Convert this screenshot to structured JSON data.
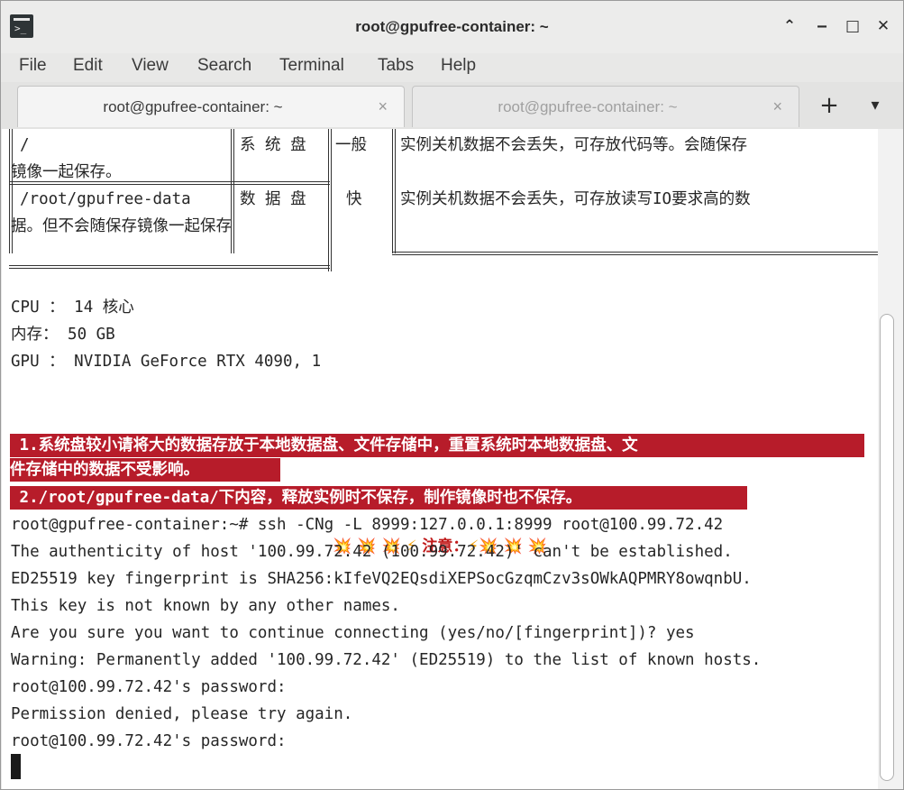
{
  "window": {
    "title": "root@gpufree-container: ~",
    "icon": "terminal-icon",
    "controls": {
      "up": "⌃",
      "minimize": "‒",
      "maximize": "□",
      "close": "✕"
    }
  },
  "menu": [
    "File",
    "Edit",
    "View",
    "Search",
    "Terminal",
    "Tabs",
    "Help"
  ],
  "tabs": [
    {
      "label": "root@gpufree-container: ~",
      "active": true,
      "close": "×"
    },
    {
      "label": "root@gpufree-container: ~",
      "active": false,
      "close": "×"
    }
  ],
  "tab_actions": {
    "new_tab": "+",
    "menu": "▾"
  },
  "terminal": {
    "table": {
      "row1_path": "/",
      "row1_type": "系 统 盘",
      "row1_speed": "一般",
      "row1_desc": "实例关机数据不会丢失，可存放代码等。会随保存",
      "row1_cont": "镜像一起保存。",
      "row2_path": "/root/gpufree-data",
      "row2_type": "数 据 盘",
      "row2_speed": "快",
      "row2_desc": "实例关机数据不会丢失，可存放读写IO要求高的数",
      "row2_cont": "据。但不会随保存镜像一起保存"
    },
    "specs": {
      "cpu": "CPU ： 14 核心",
      "mem": "内存： 50 GB",
      "gpu": "GPU ： NVIDIA GeForce RTX 4090, 1"
    },
    "notice": {
      "left_bursts": "💥 💥 💥",
      "bolt": "⚡",
      "label": "注意：",
      "right_bursts": "💥 💥 💥"
    },
    "warnings": {
      "w1a": " 1.系统盘较小请将大的数据存放于本地数据盘、文件存储中，重置系统时本地数据盘、文",
      "w1b": "件存储中的数据不受影响。",
      "w2": " 2./root/gpufree-data/下内容，释放实例时不保存，制作镜像时也不保存。"
    },
    "output": [
      "root@gpufree-container:~# ssh -CNg -L 8999:127.0.0.1:8999 root@100.99.72.42",
      "The authenticity of host '100.99.72.42 (100.99.72.42)' can't be established.",
      "ED25519 key fingerprint is SHA256:kIfeVQ2EQsdiXEPSocGzqmCzv3sOWkAQPMRY8owqnbU.",
      "This key is not known by any other names.",
      "Are you sure you want to continue connecting (yes/no/[fingerprint])? yes",
      "Warning: Permanently added '100.99.72.42' (ED25519) to the list of known hosts.",
      "root@100.99.72.42's password:",
      "Permission denied, please try again.",
      "root@100.99.72.42's password:"
    ]
  }
}
